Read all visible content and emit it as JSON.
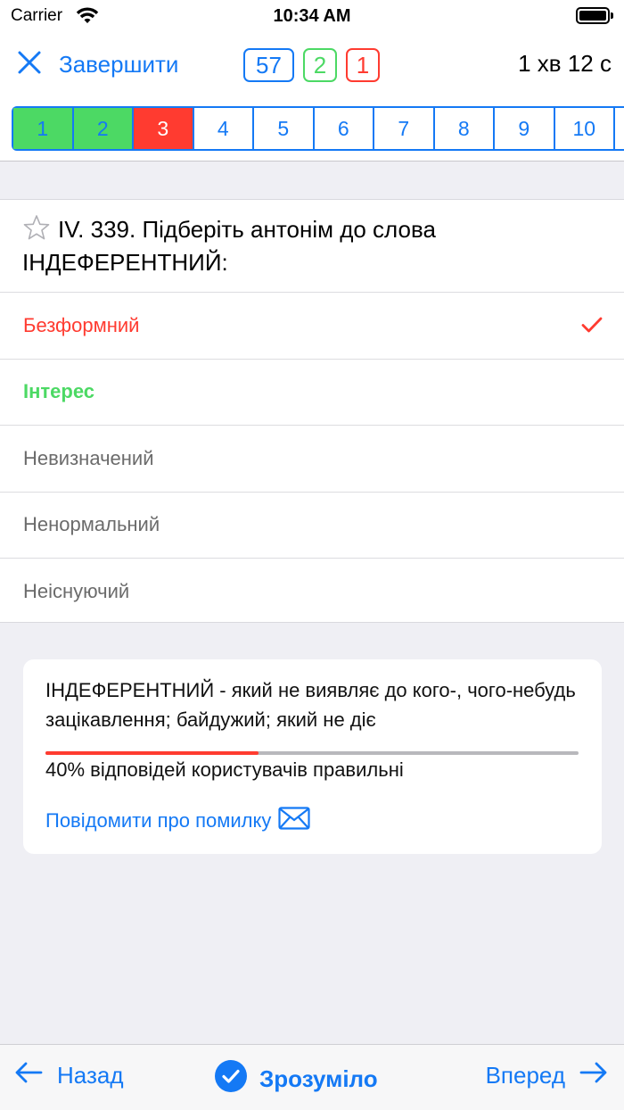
{
  "status_bar": {
    "carrier": "Carrier",
    "time": "10:34 AM"
  },
  "navbar": {
    "finish_label": "Завершити",
    "counters": {
      "total": "57",
      "correct": "2",
      "wrong": "1"
    },
    "timer": "1 хв 12 с"
  },
  "question_strip": [
    {
      "num": "1",
      "state": "correct"
    },
    {
      "num": "2",
      "state": "correct"
    },
    {
      "num": "3",
      "state": "wrong"
    },
    {
      "num": "4",
      "state": "unanswered"
    },
    {
      "num": "5",
      "state": "unanswered"
    },
    {
      "num": "6",
      "state": "unanswered"
    },
    {
      "num": "7",
      "state": "unanswered"
    },
    {
      "num": "8",
      "state": "unanswered"
    },
    {
      "num": "9",
      "state": "unanswered"
    },
    {
      "num": "10",
      "state": "unanswered"
    }
  ],
  "question": {
    "text": "IV. 339. Підберіть антонім до слова ІНДЕФЕРЕНТНИЙ:",
    "answers": [
      {
        "label": "Безформний",
        "state": "selected-wrong"
      },
      {
        "label": "Інтерес",
        "state": "correct"
      },
      {
        "label": "Невизначений",
        "state": "neutral"
      },
      {
        "label": "Ненормальний",
        "state": "neutral"
      },
      {
        "label": "Неіснуючий",
        "state": "neutral"
      }
    ]
  },
  "explanation": {
    "text": "ІНДЕФЕРЕНТНИЙ - який не виявляє до кого-, чого-небудь зацікавлення; байдужий; який не діє",
    "correct_percent": 40,
    "stat_text": "40% відповідей користувачів правильні",
    "report_label": "Повідомити про помилку"
  },
  "bottom_bar": {
    "back_label": "Назад",
    "ok_label": "Зрозуміло",
    "forward_label": "Вперед"
  },
  "colors": {
    "accent": "#1479f5",
    "correct": "#4cd964",
    "wrong": "#ff3b30"
  }
}
